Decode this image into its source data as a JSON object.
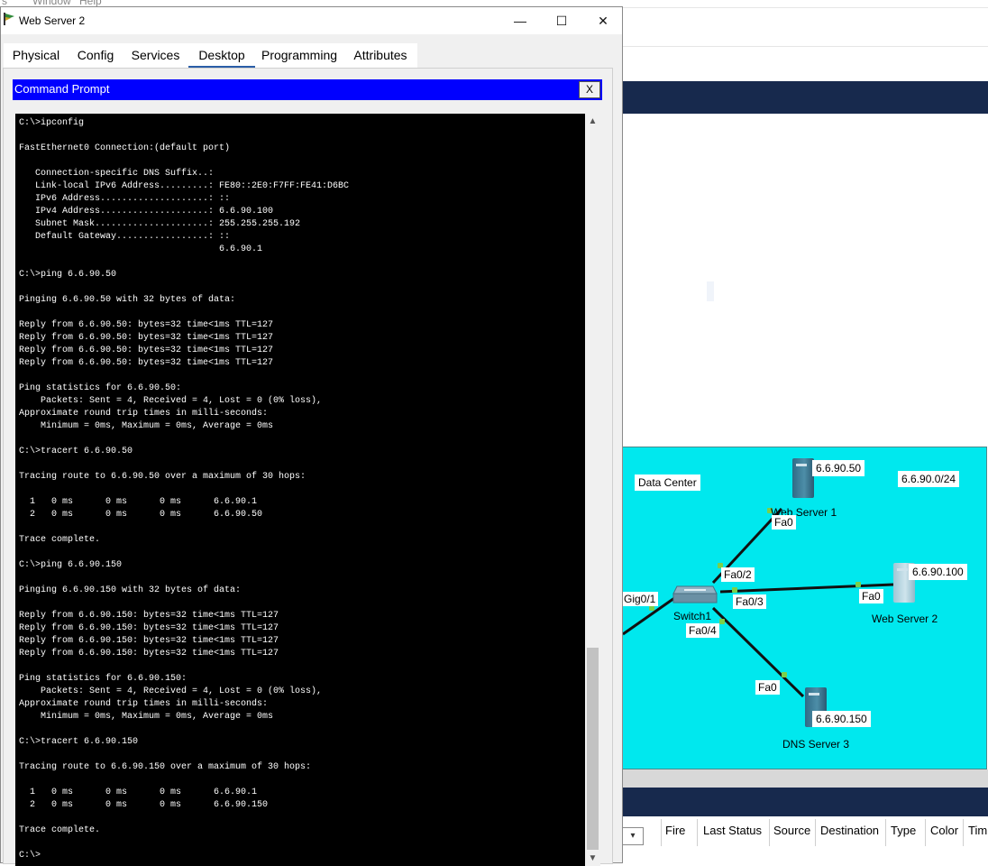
{
  "background_app": {
    "menubar_items": [
      "s",
      "Window",
      "Help"
    ],
    "device_list_columns": [
      "Fire",
      "Last Status",
      "Source",
      "Destination",
      "Type",
      "Color",
      "Tim"
    ]
  },
  "topology": {
    "area_label": "Data Center",
    "network_label": "6.6.90.0/24",
    "devices": [
      {
        "name": "Web Server 1",
        "ip": "6.6.90.50",
        "port": "Fa0"
      },
      {
        "name": "Web Server 2",
        "ip": "6.6.90.100",
        "port": "Fa0"
      },
      {
        "name": "DNS Server 3",
        "ip": "6.6.90.150",
        "port": "Fa0"
      }
    ],
    "switch": {
      "name": "Switch1",
      "ports": [
        "Fa0/2",
        "Fa0/3",
        "Fa0/4",
        "Gig0/1"
      ]
    },
    "colors": {
      "canvas": "#00e8ee",
      "link": "#111111",
      "link_dot": "#7ad04a"
    }
  },
  "window": {
    "title": "Web Server 2",
    "tabs": [
      "Physical",
      "Config",
      "Services",
      "Desktop",
      "Programming",
      "Attributes"
    ],
    "active_tab": "Desktop",
    "controls": {
      "minimize": "—",
      "maximize": "☐",
      "close": "✕"
    }
  },
  "command_prompt": {
    "title": "Command Prompt",
    "close_label": "X",
    "output": "C:\\>\nC:\\>ipconfig\n\nFastEthernet0 Connection:(default port)\n\n   Connection-specific DNS Suffix..:\n   Link-local IPv6 Address.........: FE80::2E0:F7FF:FE41:D6BC\n   IPv6 Address....................: ::\n   IPv4 Address....................: 6.6.90.100\n   Subnet Mask.....................: 255.255.255.192\n   Default Gateway.................: ::\n                                     6.6.90.1\n\nC:\\>ping 6.6.90.50\n\nPinging 6.6.90.50 with 32 bytes of data:\n\nReply from 6.6.90.50: bytes=32 time<1ms TTL=127\nReply from 6.6.90.50: bytes=32 time<1ms TTL=127\nReply from 6.6.90.50: bytes=32 time<1ms TTL=127\nReply from 6.6.90.50: bytes=32 time<1ms TTL=127\n\nPing statistics for 6.6.90.50:\n    Packets: Sent = 4, Received = 4, Lost = 0 (0% loss),\nApproximate round trip times in milli-seconds:\n    Minimum = 0ms, Maximum = 0ms, Average = 0ms\n\nC:\\>tracert 6.6.90.50\n\nTracing route to 6.6.90.50 over a maximum of 30 hops:\n\n  1   0 ms      0 ms      0 ms      6.6.90.1\n  2   0 ms      0 ms      0 ms      6.6.90.50\n\nTrace complete.\n\nC:\\>ping 6.6.90.150\n\nPinging 6.6.90.150 with 32 bytes of data:\n\nReply from 6.6.90.150: bytes=32 time<1ms TTL=127\nReply from 6.6.90.150: bytes=32 time<1ms TTL=127\nReply from 6.6.90.150: bytes=32 time<1ms TTL=127\nReply from 6.6.90.150: bytes=32 time<1ms TTL=127\n\nPing statistics for 6.6.90.150:\n    Packets: Sent = 4, Received = 4, Lost = 0 (0% loss),\nApproximate round trip times in milli-seconds:\n    Minimum = 0ms, Maximum = 0ms, Average = 0ms\n\nC:\\>tracert 6.6.90.150\n\nTracing route to 6.6.90.150 over a maximum of 30 hops:\n\n  1   0 ms      0 ms      0 ms      6.6.90.1\n  2   0 ms      0 ms      0 ms      6.6.90.150\n\nTrace complete.\n\nC:\\>",
    "scroll_position": 0.92,
    "colors": {
      "background": "#000000",
      "text": "#ffffff",
      "title_bar": "#0000ff"
    }
  }
}
